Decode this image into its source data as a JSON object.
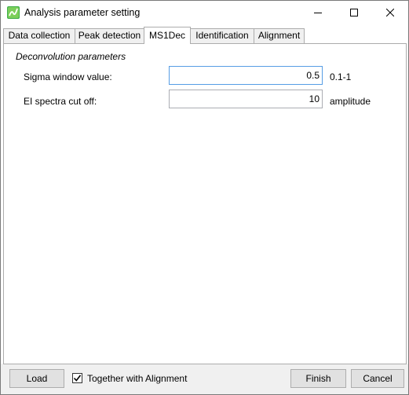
{
  "window": {
    "title": "Analysis parameter setting"
  },
  "tabs": [
    {
      "label": "Data collection"
    },
    {
      "label": "Peak detection"
    },
    {
      "label": "MS1Dec"
    },
    {
      "label": "Identification"
    },
    {
      "label": "Alignment"
    }
  ],
  "active_tab": "MS1Dec",
  "deconvolution": {
    "group_title": "Deconvolution parameters",
    "params": [
      {
        "label": "Sigma window value:",
        "value": "0.5",
        "unit": "0.1-1"
      },
      {
        "label": "EI spectra cut off:",
        "value": "10",
        "unit": "amplitude"
      }
    ]
  },
  "footer": {
    "load_label": "Load",
    "together_label": "Together with Alignment",
    "together_checked": true,
    "finish_label": "Finish",
    "cancel_label": "Cancel"
  },
  "colors": {
    "focus_border": "#569de5",
    "app_icon_green": "#3fae49"
  },
  "icons": {
    "app": "app-icon",
    "minimize": "minimize-icon",
    "maximize": "maximize-icon",
    "close": "close-icon",
    "check": "checkmark-icon"
  }
}
